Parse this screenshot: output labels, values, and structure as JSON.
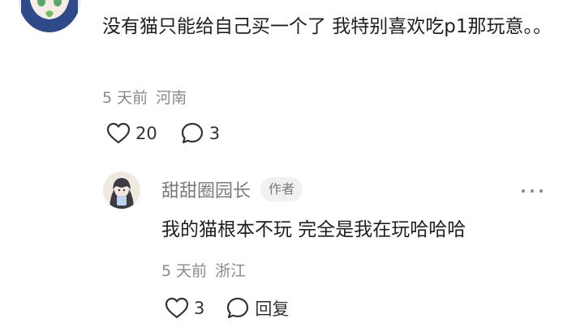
{
  "comment": {
    "text": "没有猫只能给自己买一个了 我特别喜欢吃p1那玩意。。",
    "time": "5 天前",
    "location": "河南",
    "like_count": "20",
    "reply_count": "3"
  },
  "reply": {
    "author": "甜甜圈园长",
    "badge": "作者",
    "text": "我的猫根本不玩 完全是我在玩哈哈哈",
    "time": "5 天前",
    "location": "浙江",
    "like_count": "3",
    "reply_label": "回复"
  }
}
